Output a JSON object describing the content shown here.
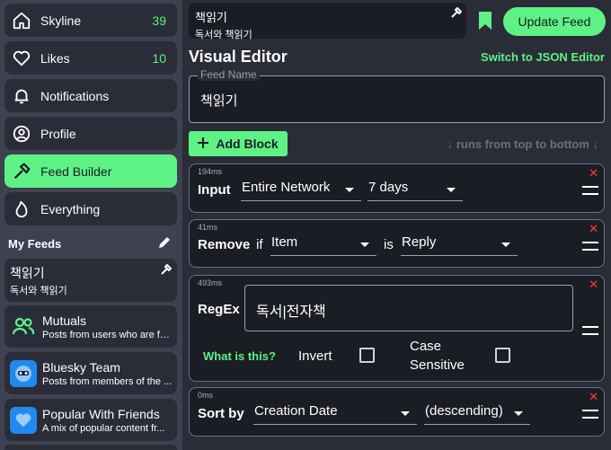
{
  "colors": {
    "accent": "#5ef285",
    "danger": "#ff3b3b"
  },
  "sidebar": {
    "items": [
      {
        "label": "Skyline",
        "count": "39",
        "icon": "home-icon"
      },
      {
        "label": "Likes",
        "count": "10",
        "icon": "heart-icon"
      },
      {
        "label": "Notifications",
        "count": "",
        "icon": "bell-icon"
      },
      {
        "label": "Profile",
        "count": "",
        "icon": "user-circle-icon"
      },
      {
        "label": "Feed Builder",
        "count": "",
        "icon": "hammer-icon"
      },
      {
        "label": "Everything",
        "count": "",
        "icon": "flame-icon"
      }
    ],
    "my_feeds_title": "My Feeds",
    "feeds": [
      {
        "name": "책읽기",
        "desc": "독서와 책읽기"
      },
      {
        "name": "Mutuals",
        "desc": "Posts from users who are fo..."
      },
      {
        "name": "Bluesky Team",
        "desc": "Posts from members of the ..."
      },
      {
        "name": "Popular With Friends",
        "desc": "A mix of popular content fr..."
      }
    ]
  },
  "header": {
    "feed_title": "책읽기",
    "feed_desc": "독서와 책읽기",
    "update_label": "Update Feed"
  },
  "editor": {
    "title": "Visual Editor",
    "switch_label": "Switch to JSON Editor",
    "feed_name_label": "Feed Name",
    "feed_name_value": "책읽기",
    "add_block_label": "Add Block",
    "runs_hint": "↓ runs from top to bottom ↓"
  },
  "blocks": {
    "input": {
      "ms": "194ms",
      "name": "Input",
      "source": "Entire Network",
      "range": "7 days"
    },
    "remove": {
      "ms": "41ms",
      "name": "Remove",
      "if": "if",
      "field": "Item",
      "is": "is",
      "value": "Reply"
    },
    "regex": {
      "ms": "493ms",
      "name": "RegEx",
      "pattern": "독서|전자책",
      "help": "What is this?",
      "invert": "Invert",
      "case1": "Case",
      "case2": "Sensitive"
    },
    "sort": {
      "ms": "0ms",
      "name": "Sort by",
      "field": "Creation Date",
      "order": "(descending)"
    }
  }
}
